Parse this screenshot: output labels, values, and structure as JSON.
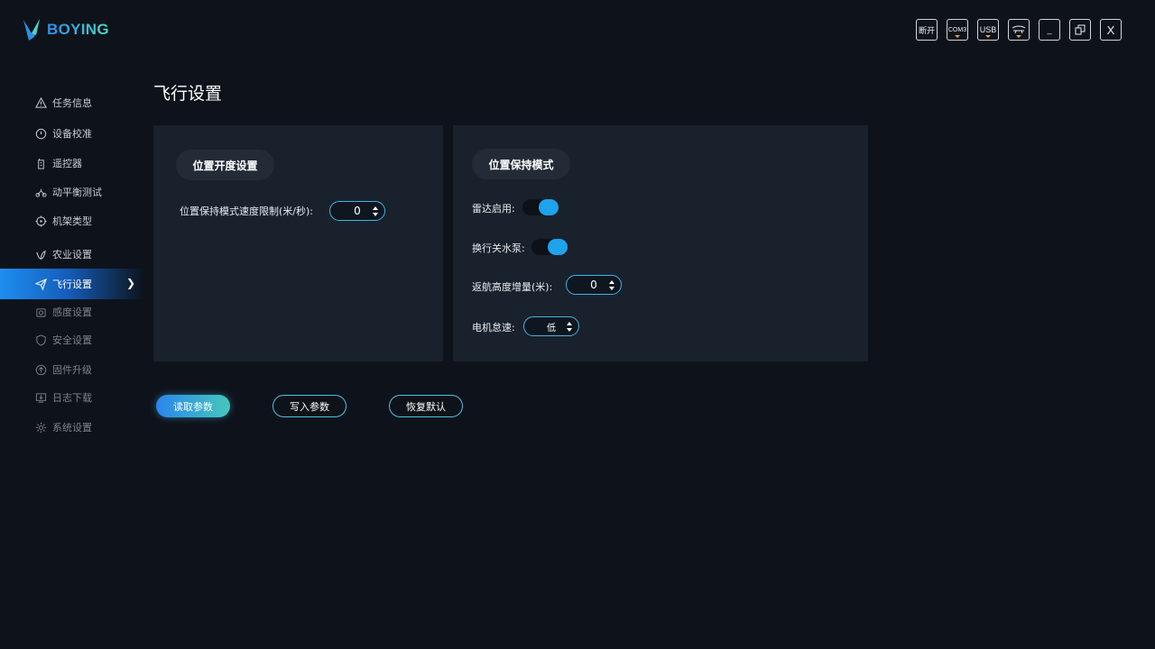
{
  "app": {
    "brand": "BOYING"
  },
  "header": {
    "tools": [
      {
        "label": "断开",
        "icon": "disconnect-icon"
      },
      {
        "label": "COM3",
        "icon": "com-port-icon"
      },
      {
        "label": "USB",
        "icon": "usb-icon"
      },
      {
        "label": "",
        "icon": "drone-icon"
      },
      {
        "label": "_",
        "icon": "minimize-icon"
      },
      {
        "label": "",
        "icon": "restore-icon"
      },
      {
        "label": "X",
        "icon": "close-icon"
      }
    ]
  },
  "sidebar": {
    "items": [
      {
        "label": "任务信息",
        "icon": "warning-icon"
      },
      {
        "label": "设备校准",
        "icon": "compass-icon"
      },
      {
        "label": "遥控器",
        "icon": "remote-controller-icon"
      },
      {
        "label": "动平衡测试",
        "icon": "balance-icon"
      },
      {
        "label": "机架类型",
        "icon": "crosshair-icon"
      },
      {
        "label": "农业设置",
        "icon": "leaf-icon"
      },
      {
        "label": "飞行设置",
        "icon": "plane-icon",
        "active": true
      },
      {
        "label": "感度设置",
        "icon": "sensor-icon"
      },
      {
        "label": "安全设置",
        "icon": "shield-icon"
      },
      {
        "label": "固件升级",
        "icon": "upgrade-icon"
      },
      {
        "label": "日志下载",
        "icon": "download-icon"
      },
      {
        "label": "系统设置",
        "icon": "gear-icon"
      }
    ]
  },
  "main": {
    "title": "飞行设置",
    "left_panel": {
      "title": "位置开度设置",
      "speed_limit_label": "位置保持模式速度限制(米/秒):",
      "speed_limit_value": "0"
    },
    "right_panel": {
      "title": "位置保持模式",
      "radar_label": "雷达启用:",
      "radar_enabled": true,
      "pump_label": "换行关水泵:",
      "pump_enabled": true,
      "rth_label": "返航高度增量(米):",
      "rth_value": "0",
      "motor_label": "电机怠速:",
      "motor_value": "低"
    },
    "buttons": {
      "read": "读取参数",
      "write": "写入参数",
      "restore": "恢复默认"
    }
  },
  "colors": {
    "accent": "#1ea3ec",
    "background": "#0e131b",
    "panel": "#19212c"
  }
}
